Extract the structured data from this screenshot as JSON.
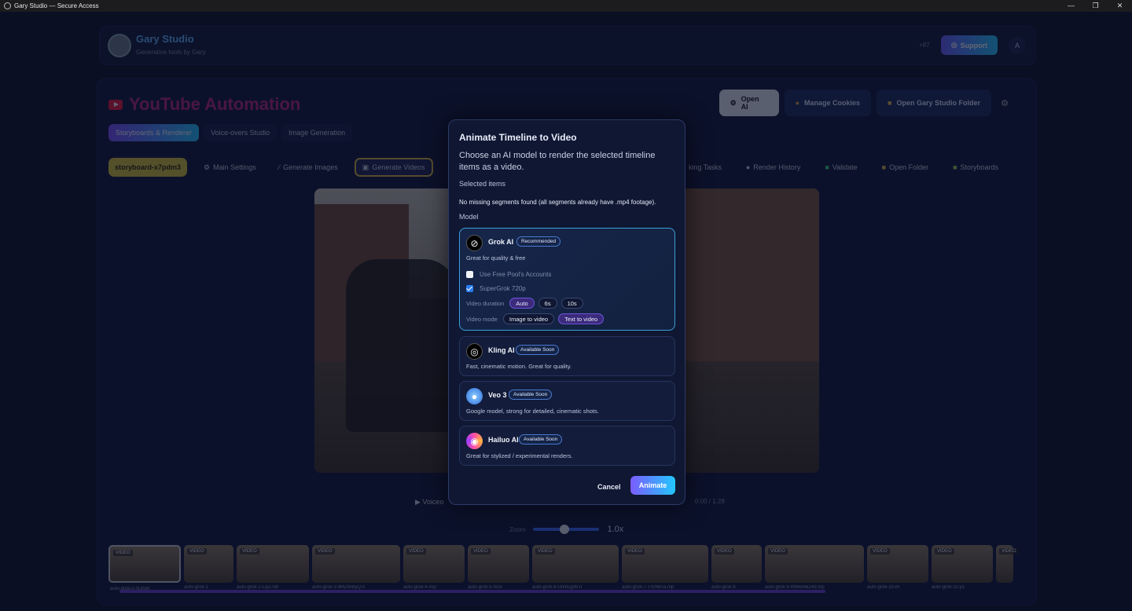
{
  "window": {
    "title": "Gary Studio — Secure Access",
    "controls": [
      "—",
      "❐",
      "✕"
    ]
  },
  "header": {
    "brand": "Gary Studio",
    "tagline": "Generative tools by Gary",
    "count": "+87",
    "support_label": "Support",
    "avatar_initial": "A"
  },
  "page": {
    "title": "YouTube Automation"
  },
  "top_actions": {
    "open_ai": "Open AI",
    "manage_cookies": "Manage Cookies",
    "open_folder": "Open Gary Studio Folder"
  },
  "tabs": [
    "Storyboards & Renderer",
    "Voice-overs Studio",
    "Image Generation"
  ],
  "subbar": {
    "storyboard_id": "storyboard-x7pdm3",
    "main_settings": "Main Settings",
    "generate_images": "Generate Images",
    "generate_videos": "Generate Videos",
    "right": [
      "king Tasks",
      "Render History",
      "Validate",
      "Open Folder",
      "Storyboards"
    ]
  },
  "player": {
    "voiceover": "▶ Voiceo",
    "timecode": "0:00 / 1:28",
    "zoom_label": "Zoom",
    "zoom_value": "1.0x",
    "zoom_level": 0.45
  },
  "filmstrip": [
    {
      "tag": "VIDEO",
      "cap": "auto-grok-0-nUh5K"
    },
    {
      "tag": "VIDEO",
      "cap": "auto-grok-1"
    },
    {
      "tag": "VIDEO",
      "cap": "auto-grok-2-LqD7xb"
    },
    {
      "tag": "VIDEO",
      "cap": "auto-grok-3-9MZWByQ.n"
    },
    {
      "tag": "VIDEO",
      "cap": "auto-grok-4-Aq7"
    },
    {
      "tag": "VIDEO",
      "cap": "auto-grok-5-hD5"
    },
    {
      "tag": "VIDEO",
      "cap": "auto-grok-6-Unihug08.n"
    },
    {
      "tag": "VIDEO",
      "cap": "auto-grok-7-TXrN6Ta.mp"
    },
    {
      "tag": "VIDEO",
      "cap": "auto-grok-8"
    },
    {
      "tag": "VIDEO",
      "cap": "auto-grok-9-WMemB24d.mp"
    },
    {
      "tag": "VIDEO",
      "cap": "auto-grok-10-M"
    },
    {
      "tag": "VIDEO",
      "cap": "auto-grok-11-y1"
    },
    {
      "tag": "VIDEO",
      "cap": ""
    }
  ],
  "modal": {
    "title": "Animate Timeline to Video",
    "description": "Choose an AI model to render the selected timeline items as a video.",
    "selected_items_label": "Selected items",
    "missing_note": "No missing segments found (all segments already have .mp4 footage).",
    "model_label": "Model",
    "models": [
      {
        "name": "Grok AI",
        "badge": "Recommended",
        "desc": "Great for quality & free"
      },
      {
        "name": "Kling AI",
        "badge": "Available Soon",
        "desc": "Fast, cinematic motion. Great for quality."
      },
      {
        "name": "Veo 3",
        "badge": "Available Soon",
        "desc": "Google model, strong for detailed, cinematic shots."
      },
      {
        "name": "Hailuo AI",
        "badge": "Available Soon",
        "desc": "Great for stylized / experimental renders."
      }
    ],
    "grok_options": {
      "free_pool": "Use Free Pool's Accounts",
      "free_pool_checked": false,
      "supergrok": "SuperGrok 720p",
      "supergrok_checked": true,
      "duration_label": "Video duration",
      "durations": [
        "Auto",
        "6s",
        "10s"
      ],
      "duration_selected": "Auto",
      "mode_label": "Video mode",
      "modes": [
        "Image to video",
        "Text to video"
      ],
      "mode_selected": "Text to video"
    },
    "cancel_label": "Cancel",
    "animate_label": "Animate"
  },
  "colors": {
    "accent": "#7b5cff",
    "accent2": "#22c7ff",
    "selected_border": "#3aa0d8",
    "youtube_red": "#e8163a"
  }
}
